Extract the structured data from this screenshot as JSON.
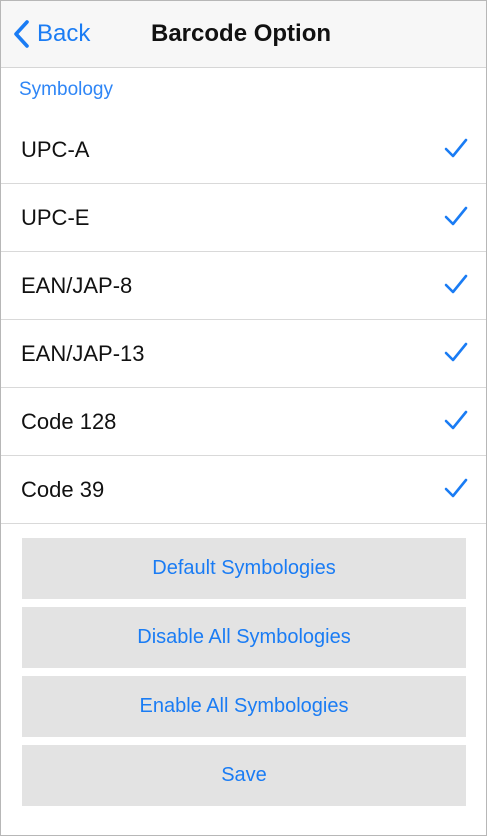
{
  "navbar": {
    "back_label": "Back",
    "title": "Barcode Option",
    "back_icon": "chevron-left-icon"
  },
  "section": {
    "header": "Symbology"
  },
  "symbologies": [
    {
      "label": "UPC-A",
      "checked": true
    },
    {
      "label": "UPC-E",
      "checked": true
    },
    {
      "label": "EAN/JAP-8",
      "checked": true
    },
    {
      "label": "EAN/JAP-13",
      "checked": true
    },
    {
      "label": "Code 128",
      "checked": true
    },
    {
      "label": "Code 39",
      "checked": true
    }
  ],
  "actions": {
    "default_label": "Default Symbologies",
    "disable_all_label": "Disable All Symbologies",
    "enable_all_label": "Enable All Symbologies",
    "save_label": "Save"
  },
  "colors": {
    "accent": "#1a7cf4",
    "button_bg": "#e3e3e3",
    "navbar_bg": "#f7f7f7",
    "separator": "#d9d9d9"
  },
  "icons": {
    "row_check": "checkmark-icon"
  }
}
